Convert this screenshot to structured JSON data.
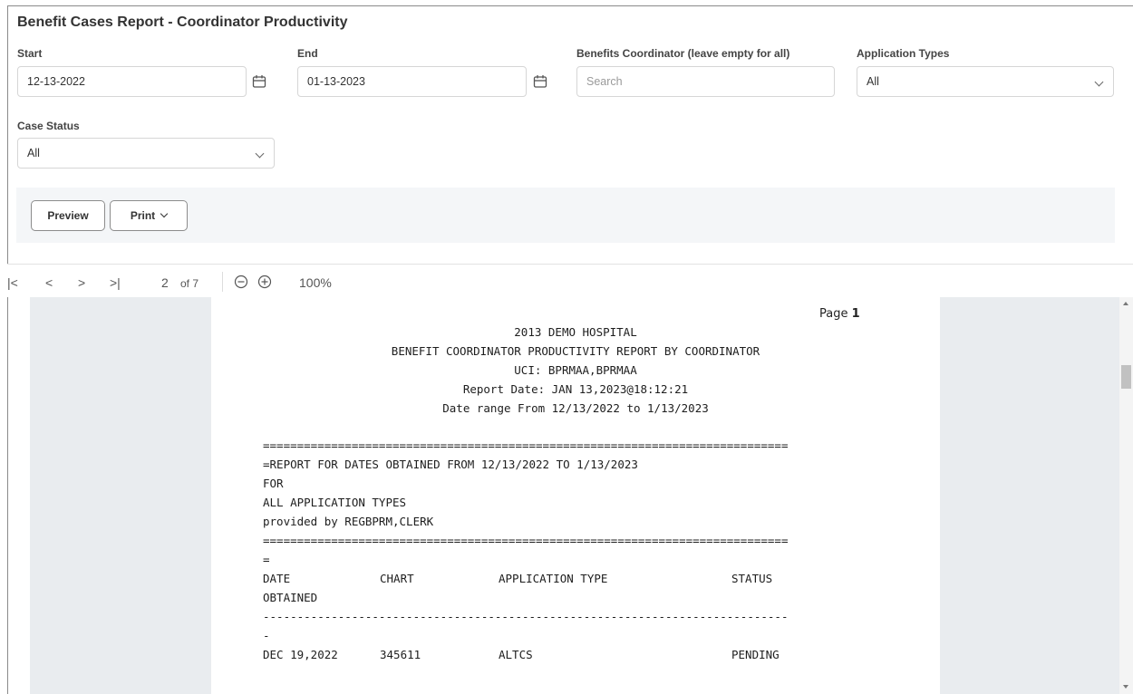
{
  "title": "Benefit Cases Report - Coordinator Productivity",
  "filters": {
    "start": {
      "label": "Start",
      "value": "12-13-2022"
    },
    "end": {
      "label": "End",
      "value": "01-13-2023"
    },
    "coordinator": {
      "label": "Benefits Coordinator (leave empty for all)",
      "placeholder": "Search"
    },
    "app_types": {
      "label": "Application Types",
      "value": "All"
    },
    "case_status": {
      "label": "Case Status",
      "value": "All"
    }
  },
  "buttons": {
    "preview": "Preview",
    "print": "Print"
  },
  "toolbar": {
    "first": "|<",
    "prev": "<",
    "next": ">",
    "last": ">|",
    "page": "2",
    "of": "of 7",
    "zoom": "100%"
  },
  "report": {
    "page_label": "Page",
    "page_num": "1",
    "header": [
      "2013 DEMO HOSPITAL",
      "BENEFIT COORDINATOR PRODUCTIVITY REPORT BY COORDINATOR",
      "UCI: BPRMAA,BPRMAA",
      "Report Date: JAN 13,2023@18:12:21",
      "Date range From 12/13/2022 to 1/13/2023"
    ],
    "sep_eq": "=============================================================================",
    "body": [
      "=REPORT FOR DATES OBTAINED FROM 12/13/2022 TO 1/13/2023",
      "FOR",
      "ALL APPLICATION TYPES",
      "provided by REGBPRM,CLERK"
    ],
    "eq_cont": "=",
    "columns": {
      "date": "DATE",
      "chart": "CHART",
      "app_type": "APPLICATION TYPE",
      "status": "STATUS",
      "date2": "OBTAINED"
    },
    "sep_dash": "-----------------------------------------------------------------------------",
    "dash_cont": "-",
    "rows": [
      {
        "date": "DEC 19,2022",
        "chart": "345611",
        "app_type": "ALTCS",
        "status": "PENDING"
      }
    ]
  }
}
